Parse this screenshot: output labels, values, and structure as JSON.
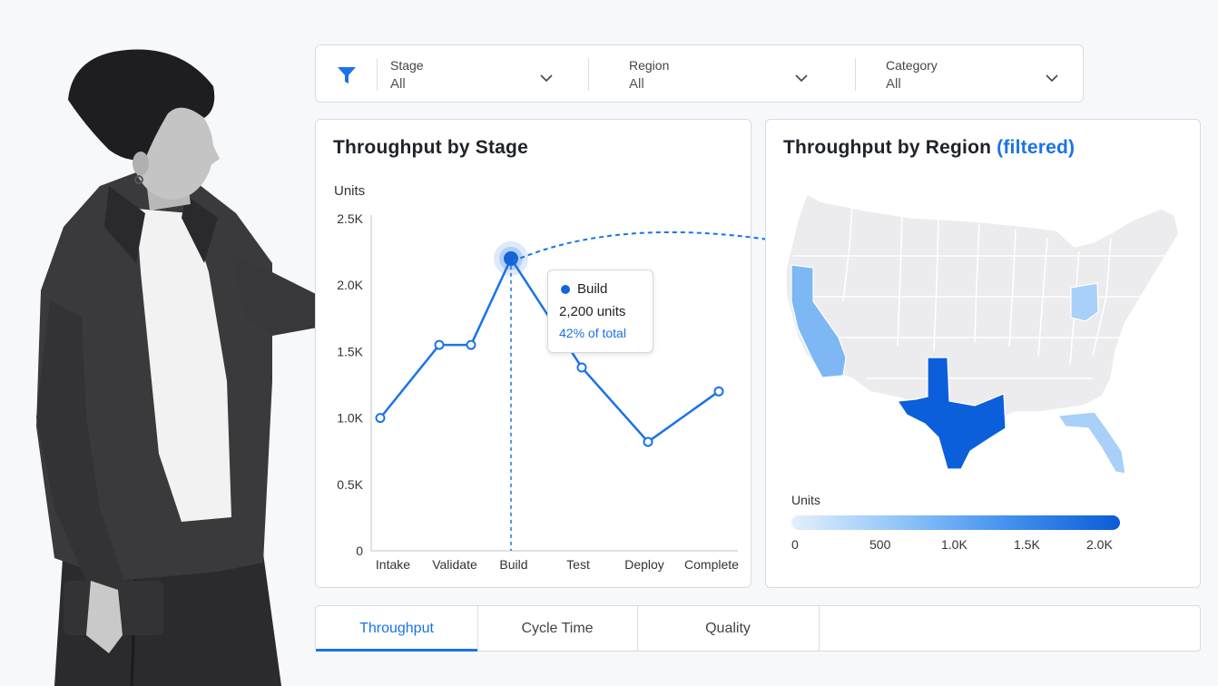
{
  "filters": [
    {
      "label": "Stage",
      "value": "All"
    },
    {
      "label": "Region",
      "value": "All"
    },
    {
      "label": "Category",
      "value": "All"
    }
  ],
  "stage_chart": {
    "title": "Throughput by Stage",
    "ylabel": "Units",
    "y_ticks": [
      "2.5K",
      "2.0K",
      "1.5K",
      "1.0K",
      "0.5K",
      "0"
    ],
    "categories": [
      "Intake",
      "Validate",
      "Build",
      "Test",
      "Deploy",
      "Complete"
    ]
  },
  "tooltip": {
    "name": "Build",
    "units": "2,200 units",
    "pct": "42% of total"
  },
  "region_map": {
    "title": "Throughput by Region",
    "title_accent": "(filtered)",
    "legend_title": "Units",
    "legend_ticks": [
      "0",
      "500",
      "1.0K",
      "1.5K",
      "2.0K"
    ]
  },
  "tabs": [
    {
      "label": "Throughput",
      "active": true
    },
    {
      "label": "Cycle Time",
      "active": false
    },
    {
      "label": "Quality",
      "active": false
    }
  ],
  "colors": {
    "accent": "#1a73e8",
    "line": "#1a73e8",
    "map_base": "#ececee",
    "map_high": "#0b5bd6"
  },
  "chart_data": {
    "type": "line",
    "title": "Throughput by Stage",
    "ylabel": "Units",
    "xlabel": "",
    "categories": [
      "Intake",
      "Validate",
      "Build",
      "Test",
      "Deploy",
      "Complete"
    ],
    "x": [
      0,
      1,
      1.5,
      2,
      3,
      4,
      5
    ],
    "values": [
      1000,
      1550,
      1550,
      2200,
      1380,
      820,
      1200
    ],
    "ylim": [
      0,
      2500
    ],
    "highlight": {
      "category": "Build",
      "value": 2200
    },
    "grid": false
  }
}
